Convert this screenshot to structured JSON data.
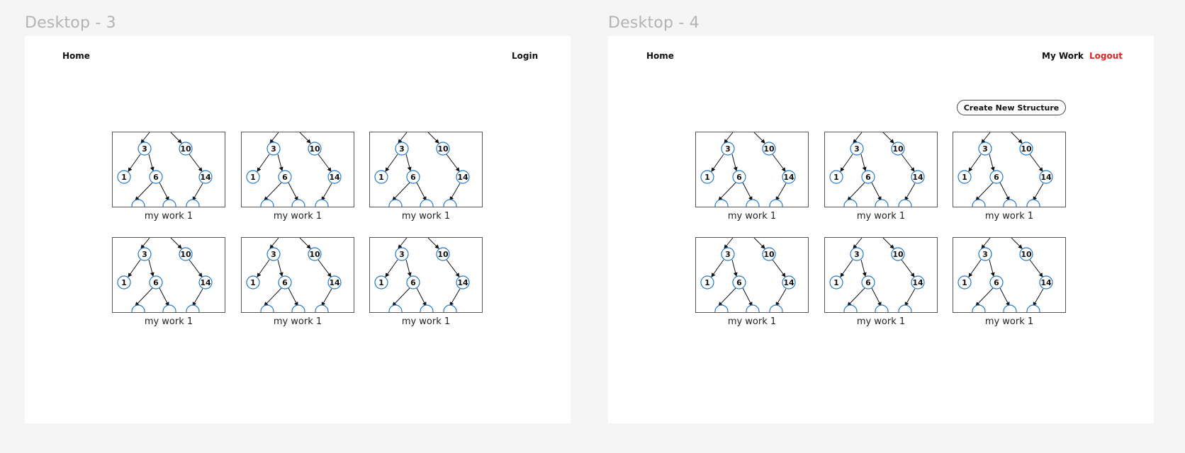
{
  "frames": [
    {
      "label": "Desktop - 3",
      "nav": {
        "home": "Home",
        "login": "Login"
      }
    },
    {
      "label": "Desktop - 4",
      "nav": {
        "home": "Home",
        "my_work": "My Work",
        "logout": "Logout"
      },
      "create_button": "Create New Structure"
    }
  ],
  "card_caption": "my work 1",
  "tree_nodes": [
    "3",
    "10",
    "1",
    "6",
    "14"
  ],
  "colors": {
    "node_stroke": "#1f78c8",
    "logout": "#e02424",
    "canvas_bg": "#f5f5f5",
    "frame_bg": "#ffffff"
  }
}
